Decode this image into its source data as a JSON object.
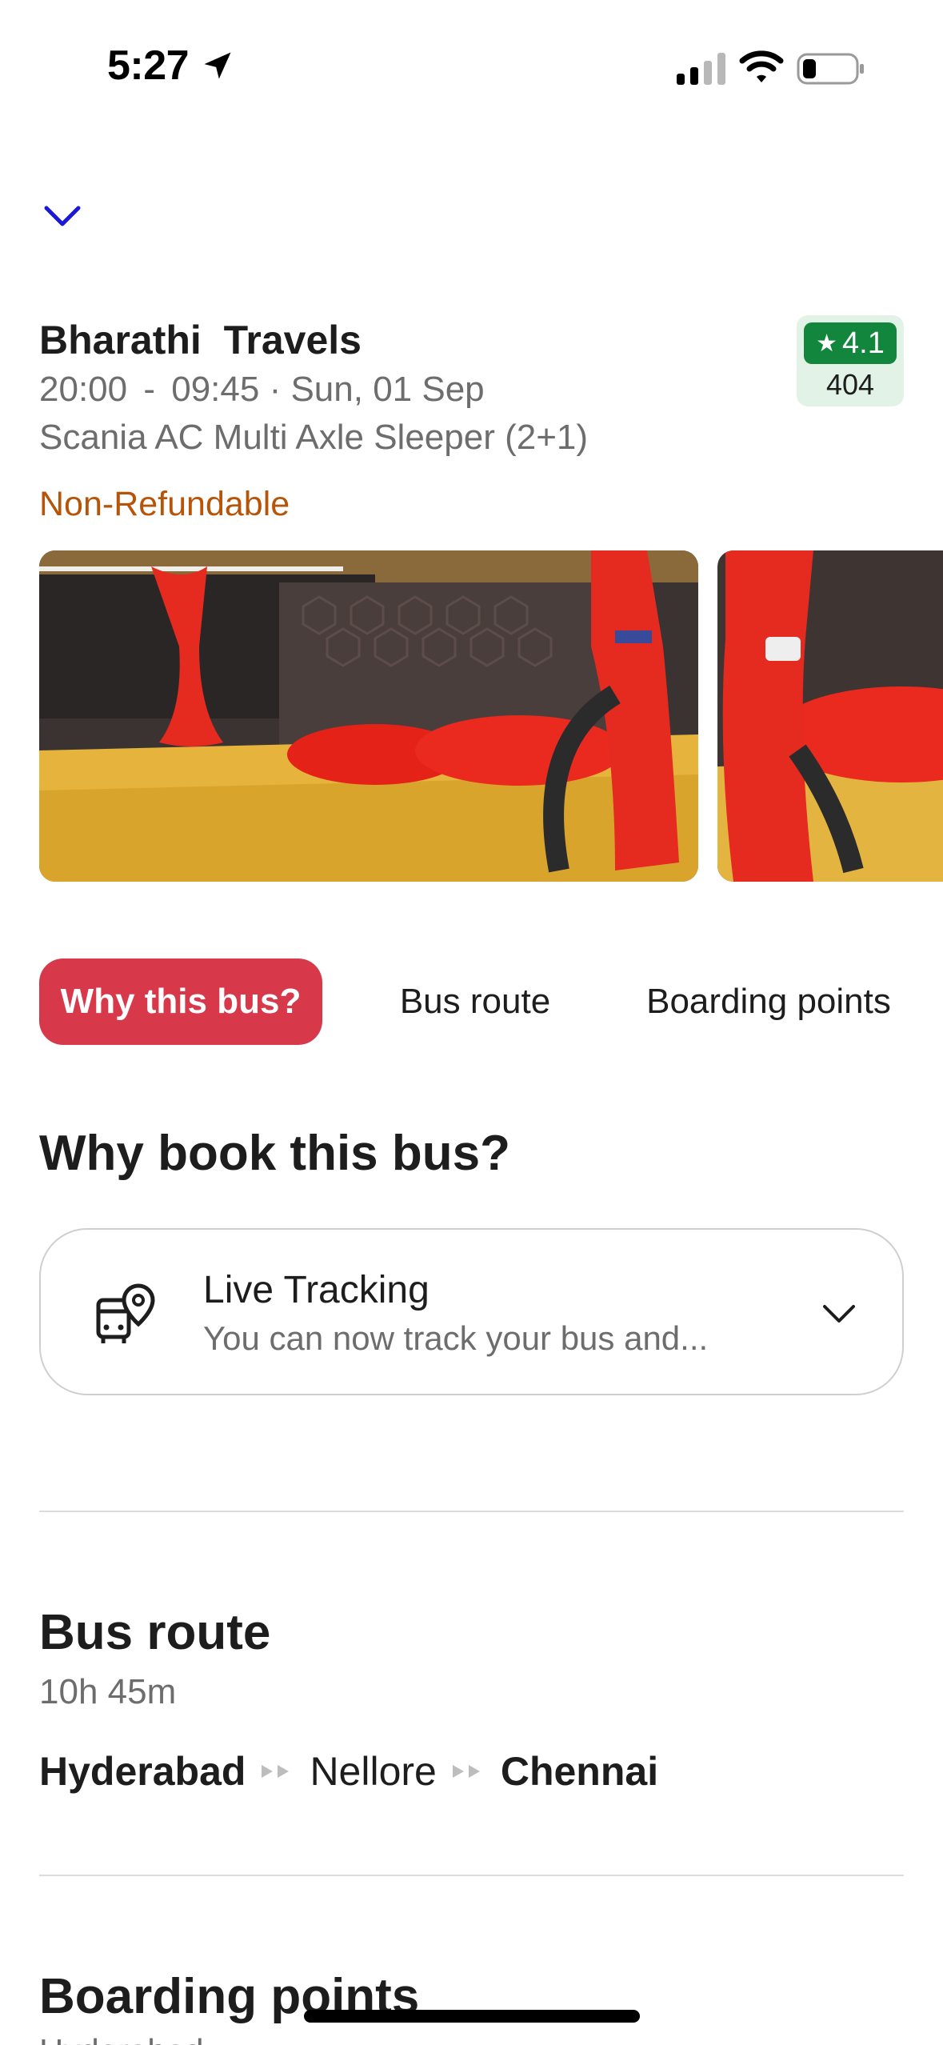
{
  "status_bar": {
    "time": "5:27",
    "icons": [
      "location-arrow-icon",
      "cellular-signal-icon",
      "wifi-icon",
      "battery-icon"
    ]
  },
  "header": {
    "collapse_icon": "chevron-down-icon"
  },
  "bus": {
    "operator": "Bharathi  Travels",
    "departure": "20:00",
    "dash": "-",
    "arrival": "09:45",
    "date": "· Sun, 01 Sep",
    "type": "Scania AC Multi Axle Sleeper (2+1)",
    "refund_policy": "Non-Refundable",
    "rating": "4.1",
    "rating_count": "404",
    "rating_icon": "star-icon"
  },
  "colors": {
    "accent": "#d7384a",
    "rating_green": "#12863c",
    "rating_bg": "#e3f2e7",
    "refund_orange": "#b65509",
    "chevron_blue": "#1a1ad6"
  },
  "tabs": [
    {
      "label": "Why this bus?",
      "active": true
    },
    {
      "label": "Bus route",
      "active": false
    },
    {
      "label": "Boarding points",
      "active": false
    }
  ],
  "why_section": {
    "title": "Why book this bus?",
    "feature": {
      "icon": "bus-location-icon",
      "title": "Live Tracking",
      "description": "You can now track your bus and..."
    }
  },
  "route_section": {
    "title": "Bus route",
    "duration": "10h 45m",
    "stops": [
      "Hyderabad",
      "Nellore",
      "Chennai"
    ]
  },
  "boarding_section": {
    "title": "Boarding points",
    "subtitle": "Hyderabad"
  }
}
